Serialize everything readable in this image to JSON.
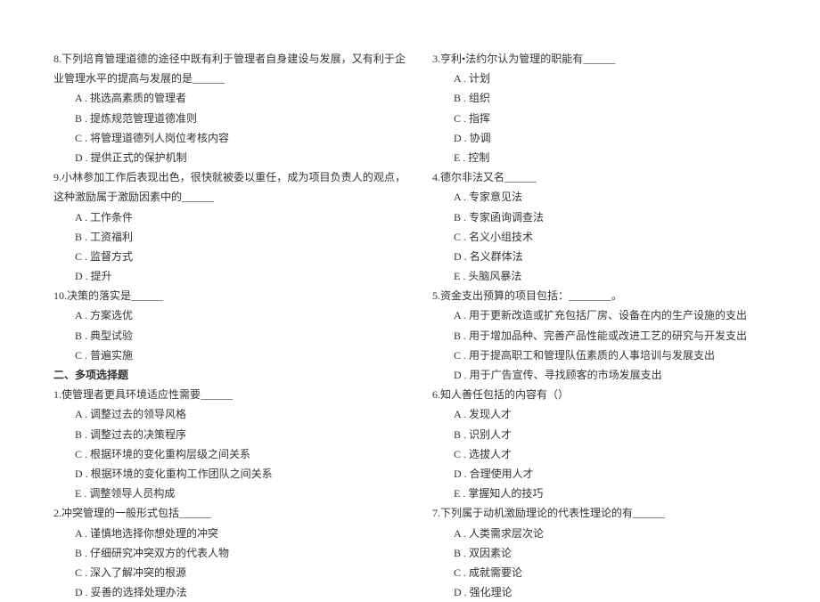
{
  "left": {
    "q8": {
      "text_part1": "8.下列培育管理道德的途径中既有利于管理者自身建设与发展，又有利于企业管理水平的提高与发展的是",
      "blank": "______",
      "options": {
        "a": "A . 挑选高素质的管理者",
        "b": "B . 提炼规范管理道德准则",
        "c": "C . 将管理道德列人岗位考核内容",
        "d": "D . 提供正式的保护机制"
      }
    },
    "q9": {
      "text_part1": "9.小林参加工作后表现出色，很快就被委以重任，成为项目负责人的观点，这种激励属于激励因素中的",
      "blank": "______",
      "options": {
        "a": "A . 工作条件",
        "b": "B . 工资福利",
        "c": "C . 监督方式",
        "d": "D . 提升"
      }
    },
    "q10": {
      "text": "10.决策的落实是______",
      "options": {
        "a": "A . 方案选优",
        "b": "B . 典型试验",
        "c": "C . 普遍实施"
      }
    },
    "section_header": "二、多项选择题",
    "mq1": {
      "text": "1.使管理者更具环境适应性需要______",
      "options": {
        "a": "A . 调整过去的领导风格",
        "b": "B . 调整过去的决策程序",
        "c": "C . 根据环境的变化重构层级之间关系",
        "d": "D . 根据环境的变化重构工作团队之间关系",
        "e": "E . 调整领导人员构成"
      }
    },
    "mq2": {
      "text": "2.冲突管理的一般形式包括______",
      "options": {
        "a": "A . 谨慎地选择你想处理的冲突",
        "b": "B . 仔细研究冲突双方的代表人物",
        "c": "C . 深入了解冲突的根源",
        "d": "D . 妥善的选择处理办法"
      }
    }
  },
  "right": {
    "q3": {
      "text": "3.亨利•法约尔认为管理的职能有______",
      "options": {
        "a": "A . 计划",
        "b": "B . 组织",
        "c": "C . 指挥",
        "d": "D . 协调",
        "e": "E . 控制"
      }
    },
    "q4": {
      "text": "4.德尔非法又名______",
      "options": {
        "a": "A . 专家意见法",
        "b": "B . 专家函询调查法",
        "c": "C . 名义小组技术",
        "d": "D . 名义群体法",
        "e": "E . 头脑风暴法"
      }
    },
    "q5": {
      "text": "5.资金支出预算的项目包括：________。",
      "options": {
        "a": "A . 用于更新改造或扩充包括厂房、设备在内的生产设施的支出",
        "b": "B . 用于增加品种、完善产品性能或改进工艺的研究与开发支出",
        "c": "C . 用于提高职工和管理队伍素质的人事培训与发展支出",
        "d": "D . 用于广告宣传、寻找顾客的市场发展支出"
      }
    },
    "q6": {
      "text": "6.知人善任包括的内容有（）",
      "options": {
        "a": "A . 发现人才",
        "b": "B . 识别人才",
        "c": "C . 选拔人才",
        "d": "D . 合理使用人才",
        "e": "E . 掌握知人的技巧"
      }
    },
    "q7": {
      "text": "7.下列属于动机激励理论的代表性理论的有______",
      "options": {
        "a": "A . 人类需求层次论",
        "b": "B . 双因素论",
        "c": "C . 成就需要论",
        "d": "D . 强化理论"
      }
    }
  }
}
